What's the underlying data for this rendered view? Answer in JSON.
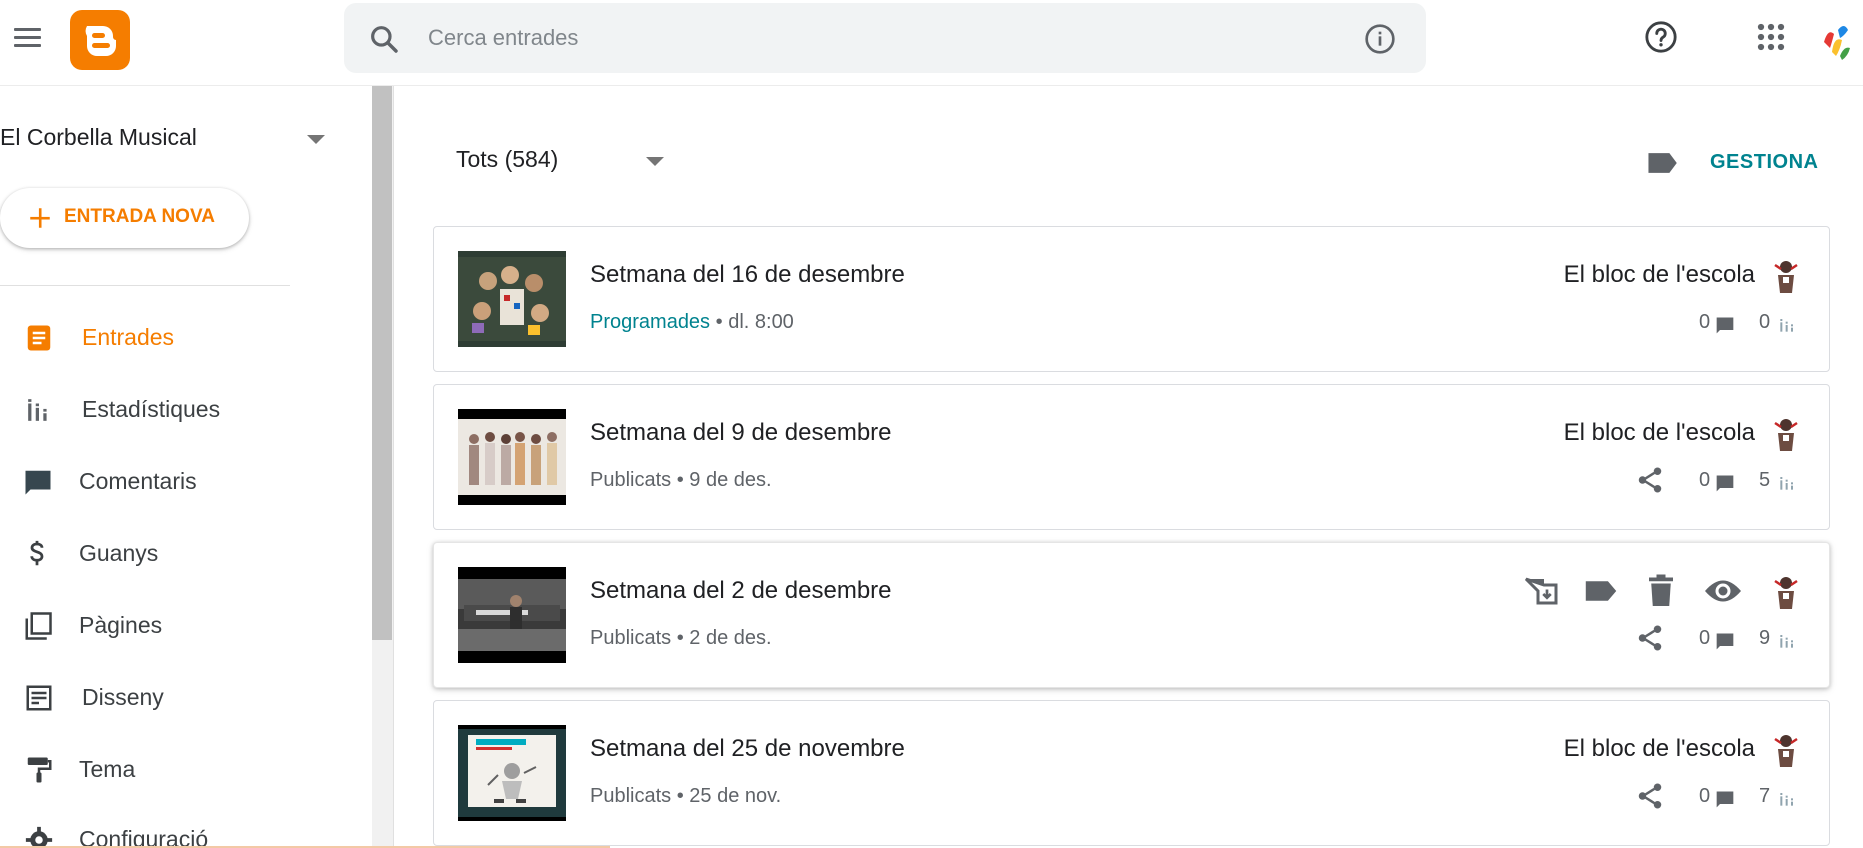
{
  "search": {
    "placeholder": "Cerca entrades"
  },
  "sidebar": {
    "blog_name": "El Corbella Musical",
    "new_post_label": "ENTRADA NOVA",
    "items": [
      {
        "label": "Entrades",
        "icon": "posts-icon"
      },
      {
        "label": "Estadístiques",
        "icon": "stats-icon"
      },
      {
        "label": "Comentaris",
        "icon": "comments-icon"
      },
      {
        "label": "Guanys",
        "icon": "dollar-icon"
      },
      {
        "label": "Pàgines",
        "icon": "pages-icon"
      },
      {
        "label": "Disseny",
        "icon": "layout-icon"
      },
      {
        "label": "Tema",
        "icon": "paint-roller-icon"
      },
      {
        "label": "Configuració",
        "icon": "gear-icon"
      }
    ]
  },
  "main": {
    "filter_label": "Tots (584)",
    "manage_label": "GESTIONA",
    "posts": [
      {
        "title": "Setmana del 16 de desembre",
        "status": "Programades",
        "date": "dl. 8:00",
        "blog": "El bloc de l'escola",
        "comments": "0",
        "views": "0"
      },
      {
        "title": "Setmana del 9 de desembre",
        "status": "Publicats",
        "date": "9 de des.",
        "blog": "El bloc de l'escola",
        "comments": "0",
        "views": "5"
      },
      {
        "title": "Setmana del 2 de desembre",
        "status": "Publicats",
        "date": "2 de des.",
        "blog": "",
        "comments": "0",
        "views": "9"
      },
      {
        "title": "Setmana del 25 de novembre",
        "status": "Publicats",
        "date": "25 de nov.",
        "blog": "El bloc de l'escola",
        "comments": "0",
        "views": "7"
      }
    ],
    "separator": "•"
  },
  "colors": {
    "brand": "#f57d00",
    "accent": "#00838f",
    "text": "#202124",
    "muted": "#5f6368"
  }
}
